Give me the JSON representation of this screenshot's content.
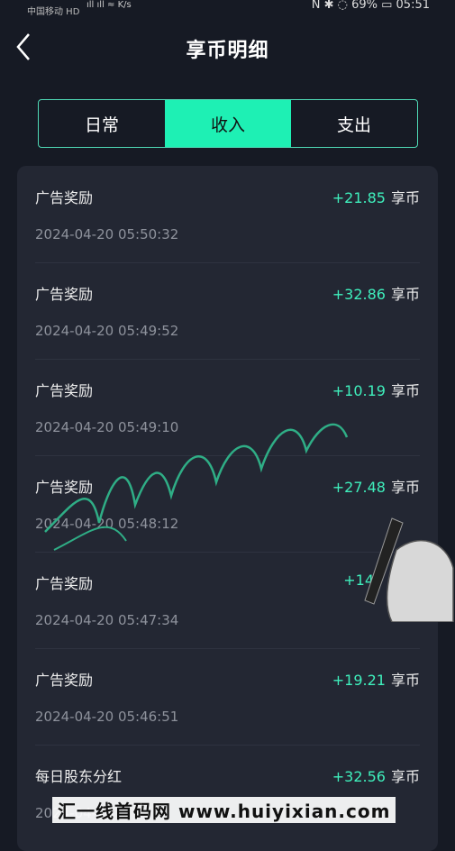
{
  "status_bar": {
    "carrier": "中国移动 HD",
    "signal": "ıll ıll ≈ K/s",
    "right": "N ✱ ◌ 69% ▭ 05:51"
  },
  "header": {
    "title": "享币明细"
  },
  "tabs": [
    {
      "label": "日常",
      "active": false
    },
    {
      "label": "收入",
      "active": true
    },
    {
      "label": "支出",
      "active": false
    }
  ],
  "records": [
    {
      "name": "广告奖励",
      "amount": "+21.85",
      "unit": "享币",
      "time": "2024-04-20 05:50:32"
    },
    {
      "name": "广告奖励",
      "amount": "+32.86",
      "unit": "享币",
      "time": "2024-04-20 05:49:52"
    },
    {
      "name": "广告奖励",
      "amount": "+10.19",
      "unit": "享币",
      "time": "2024-04-20 05:49:10"
    },
    {
      "name": "广告奖励",
      "amount": "+27.48",
      "unit": "享币",
      "time": "2024-04-20 05:48:12"
    },
    {
      "name": "广告奖励",
      "amount": "+14",
      "unit": "",
      "time": "2024-04-20 05:47:34"
    },
    {
      "name": "广告奖励",
      "amount": "+19.21",
      "unit": "享币",
      "time": "2024-04-20 05:46:51"
    },
    {
      "name": "每日股东分红",
      "amount": "+32.56",
      "unit": "享币",
      "time": "2024-04-20"
    }
  ],
  "watermark": "汇一线首码网 www.huiyixian.com",
  "colors": {
    "accent": "#1ef0b4",
    "amount": "#3ff0bd",
    "background": "#161a24",
    "card": "#232733"
  }
}
